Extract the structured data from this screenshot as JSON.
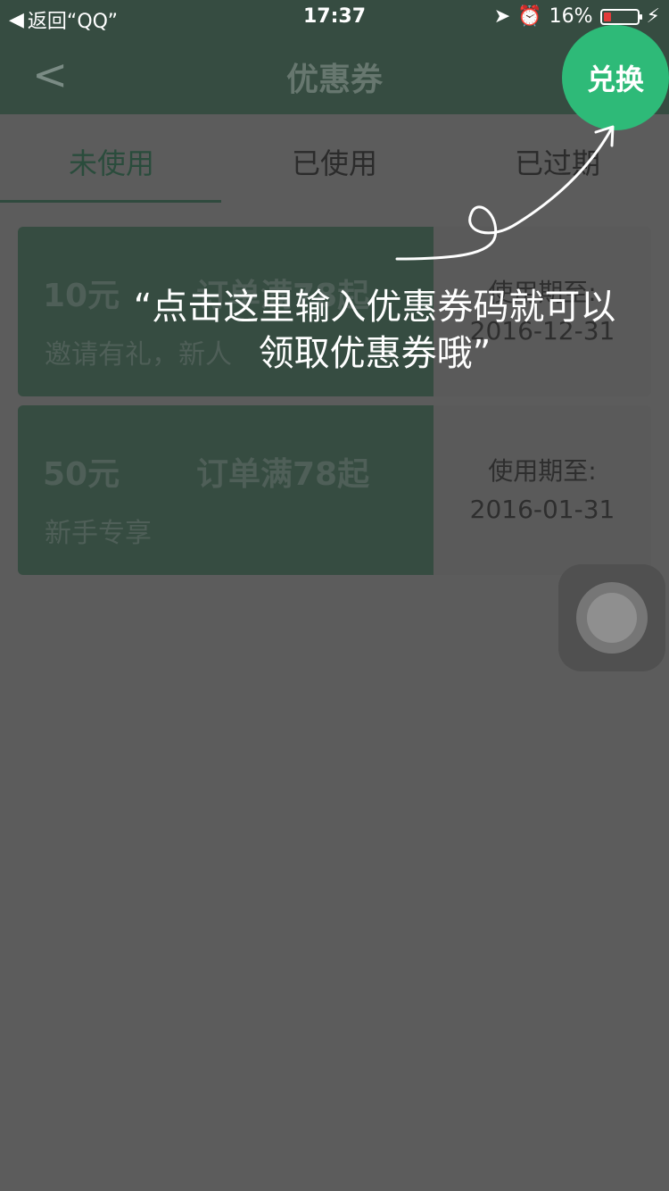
{
  "status_bar": {
    "back_label": "返回“QQ”",
    "time": "17:37",
    "battery_percent": "16%",
    "icons": [
      "back-triangle-icon",
      "location-arrow-icon",
      "alarm-icon",
      "battery-icon",
      "charging-bolt-icon"
    ]
  },
  "nav": {
    "title": "优惠券",
    "back_icon": "back-chevron-icon",
    "exchange_label": "兑换"
  },
  "tabs": [
    {
      "label": "未使用",
      "active": true
    },
    {
      "label": "已使用",
      "active": false
    },
    {
      "label": "已过期",
      "active": false
    }
  ],
  "coupons": [
    {
      "amount": "10元",
      "condition": "订单满78起",
      "description": "邀请有礼，新人",
      "valid_label": "使用期至:",
      "date": "2016-12-31"
    },
    {
      "amount": "50元",
      "condition": "订单满78起",
      "description": "新手专享",
      "valid_label": "使用期至:",
      "date": "2016-01-31"
    }
  ],
  "tip": {
    "line1": "“点击这里输入优惠券码就可以",
    "line2": "领取优惠券哦”"
  },
  "colors": {
    "accent": "#2eba78",
    "overlay": "#5c5c5c",
    "card_green": "#364c41"
  }
}
